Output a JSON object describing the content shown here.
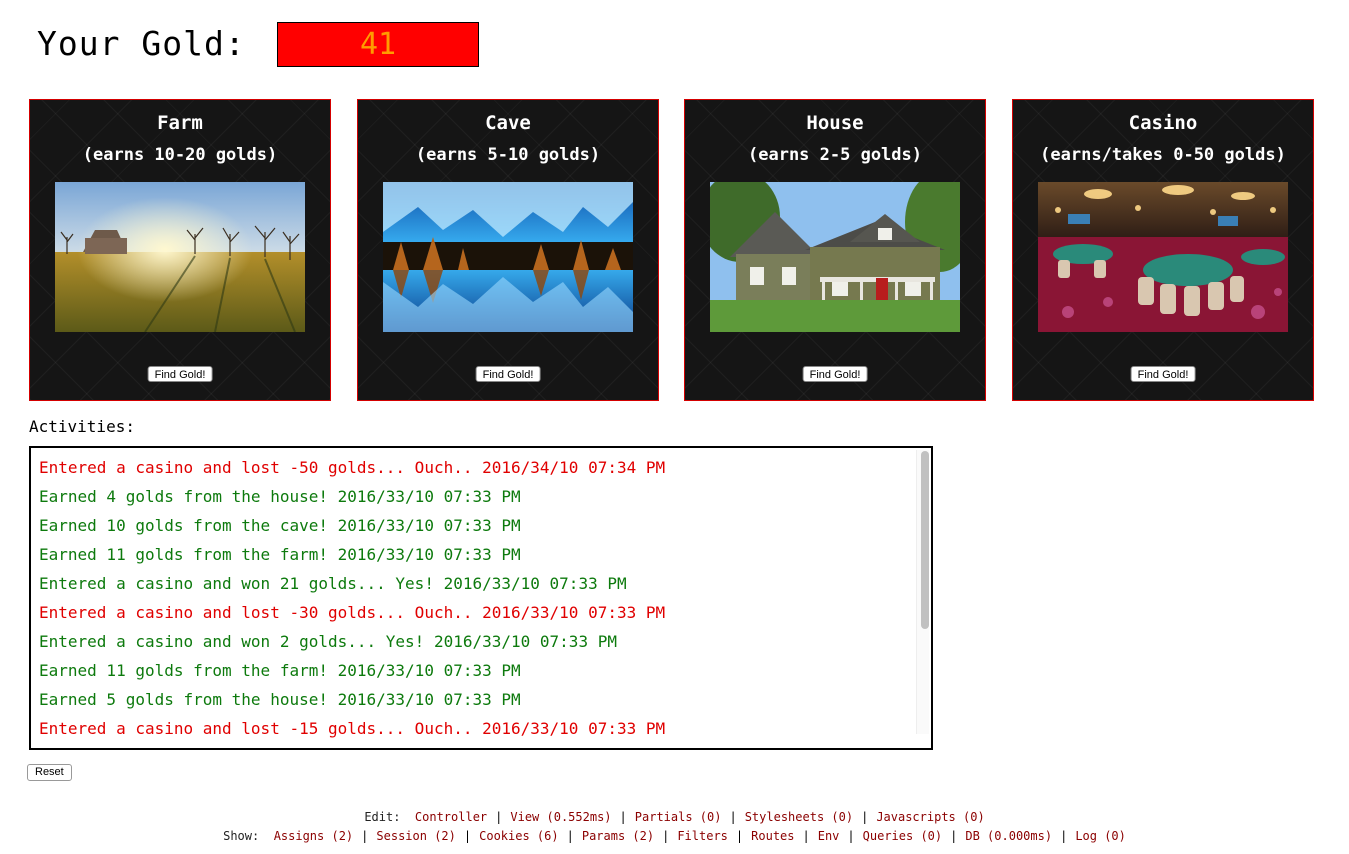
{
  "header": {
    "label": "Your Gold:",
    "gold": "41"
  },
  "cards": [
    {
      "title": "Farm",
      "subtitle": "(earns 10-20 golds)",
      "button": "Find Gold!"
    },
    {
      "title": "Cave",
      "subtitle": "(earns 5-10 golds)",
      "button": "Find Gold!"
    },
    {
      "title": "House",
      "subtitle": "(earns 2-5 golds)",
      "button": "Find Gold!"
    },
    {
      "title": "Casino",
      "subtitle": "(earns/takes 0-50 golds)",
      "button": "Find Gold!"
    }
  ],
  "activities": {
    "label": "Activities:",
    "items": [
      {
        "text": "Entered a casino and lost -50 golds... Ouch.. 2016/34/10 07:34 PM",
        "kind": "lose"
      },
      {
        "text": "Earned 4 golds from the house! 2016/33/10 07:33 PM",
        "kind": "win"
      },
      {
        "text": "Earned 10 golds from the cave! 2016/33/10 07:33 PM",
        "kind": "win"
      },
      {
        "text": "Earned 11 golds from the farm! 2016/33/10 07:33 PM",
        "kind": "win"
      },
      {
        "text": "Entered a casino and won 21 golds... Yes! 2016/33/10 07:33 PM",
        "kind": "win"
      },
      {
        "text": "Entered a casino and lost -30 golds... Ouch.. 2016/33/10 07:33 PM",
        "kind": "lose"
      },
      {
        "text": "Entered a casino and won 2 golds... Yes! 2016/33/10 07:33 PM",
        "kind": "win"
      },
      {
        "text": "Earned 11 golds from the farm! 2016/33/10 07:33 PM",
        "kind": "win"
      },
      {
        "text": "Earned 5 golds from the house! 2016/33/10 07:33 PM",
        "kind": "win"
      },
      {
        "text": "Entered a casino and lost -15 golds... Ouch.. 2016/33/10 07:33 PM",
        "kind": "lose"
      }
    ]
  },
  "reset_label": "Reset",
  "debug": {
    "edit_label": "Edit:",
    "edit_links": [
      "Controller",
      "View (0.552ms)",
      "Partials (0)",
      "Stylesheets (0)",
      "Javascripts (0)"
    ],
    "show_label": "Show:",
    "show_links": [
      "Assigns (2)",
      "Session (2)",
      "Cookies (6)",
      "Params (2)",
      "Filters",
      "Routes",
      "Env",
      "Queries (0)",
      "DB (0.000ms)",
      "Log (0)"
    ]
  },
  "colors": {
    "win": "#0d7a0d",
    "lose": "#e00000",
    "gold_box": "#ff0000",
    "gold_text": "#ff9c00",
    "card_border": "#d40000"
  }
}
